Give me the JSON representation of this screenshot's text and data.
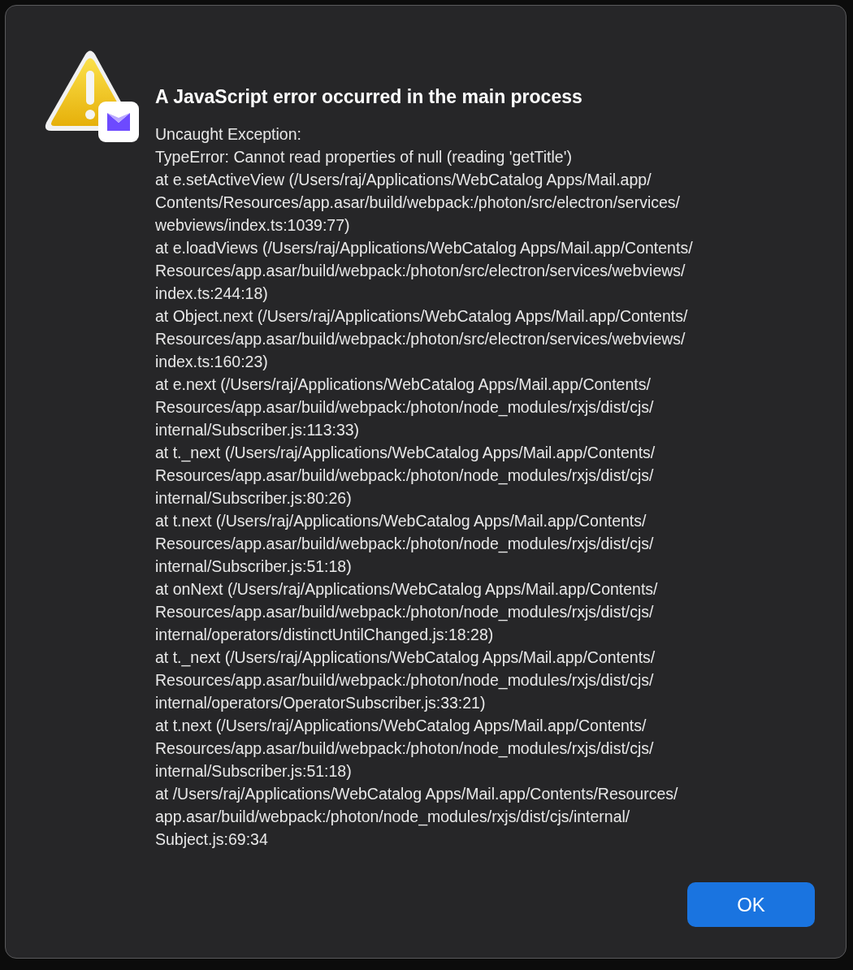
{
  "dialog": {
    "title": "A JavaScript error occurred in the main process",
    "message_lines": [
      "Uncaught Exception:",
      "TypeError: Cannot read properties of null (reading 'getTitle')",
      "at e.setActiveView (/Users/raj/Applications/WebCatalog Apps/Mail.app/",
      "Contents/Resources/app.asar/build/webpack:/photon/src/electron/services/",
      "webviews/index.ts:1039:77)",
      "at e.loadViews (/Users/raj/Applications/WebCatalog Apps/Mail.app/Contents/",
      "Resources/app.asar/build/webpack:/photon/src/electron/services/webviews/",
      "index.ts:244:18)",
      "at Object.next (/Users/raj/Applications/WebCatalog Apps/Mail.app/Contents/",
      "Resources/app.asar/build/webpack:/photon/src/electron/services/webviews/",
      "index.ts:160:23)",
      "at e.next (/Users/raj/Applications/WebCatalog Apps/Mail.app/Contents/",
      "Resources/app.asar/build/webpack:/photon/node_modules/rxjs/dist/cjs/",
      "internal/Subscriber.js:113:33)",
      "at t._next (/Users/raj/Applications/WebCatalog Apps/Mail.app/Contents/",
      "Resources/app.asar/build/webpack:/photon/node_modules/rxjs/dist/cjs/",
      "internal/Subscriber.js:80:26)",
      "at t.next (/Users/raj/Applications/WebCatalog Apps/Mail.app/Contents/",
      "Resources/app.asar/build/webpack:/photon/node_modules/rxjs/dist/cjs/",
      "internal/Subscriber.js:51:18)",
      "at onNext (/Users/raj/Applications/WebCatalog Apps/Mail.app/Contents/",
      "Resources/app.asar/build/webpack:/photon/node_modules/rxjs/dist/cjs/",
      "internal/operators/distinctUntilChanged.js:18:28)",
      "at t._next (/Users/raj/Applications/WebCatalog Apps/Mail.app/Contents/",
      "Resources/app.asar/build/webpack:/photon/node_modules/rxjs/dist/cjs/",
      "internal/operators/OperatorSubscriber.js:33:21)",
      "at t.next (/Users/raj/Applications/WebCatalog Apps/Mail.app/Contents/",
      "Resources/app.asar/build/webpack:/photon/node_modules/rxjs/dist/cjs/",
      "internal/Subscriber.js:51:18)",
      "at /Users/raj/Applications/WebCatalog Apps/Mail.app/Contents/Resources/",
      "app.asar/build/webpack:/photon/node_modules/rxjs/dist/cjs/internal/",
      "Subject.js:69:34"
    ],
    "buttons": [
      "OK"
    ]
  }
}
